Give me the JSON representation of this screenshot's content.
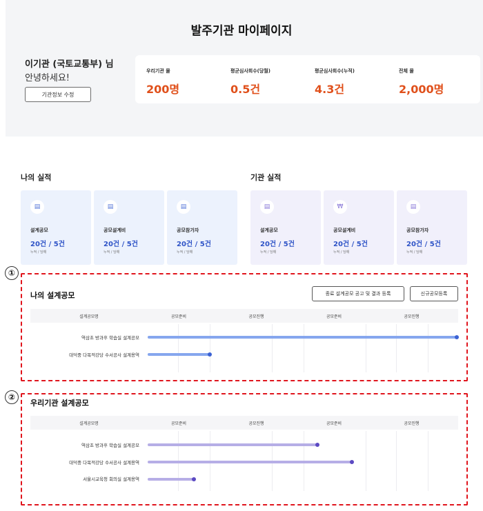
{
  "page": {
    "title": "발주기관 마이페이지"
  },
  "profile": {
    "name": "이기관 (국토교통부) 님",
    "greeting": "안녕하세요!",
    "edit_button": "기관정보 수정"
  },
  "stats": [
    {
      "label": "우리기관 몰",
      "value": "200명"
    },
    {
      "label": "평균심사회수(당월)",
      "value": "0.5건"
    },
    {
      "label": "평균심사회수(누적)",
      "value": "4.3건"
    },
    {
      "label": "전체 몰",
      "value": "2,000명"
    }
  ],
  "my_performance": {
    "title": "나의 실적",
    "cards": [
      {
        "icon": "document-icon",
        "label": "설계공모",
        "value": "20건 / 5건",
        "sub": "누적 / 당해"
      },
      {
        "icon": "document-icon",
        "label": "공모설계비",
        "value": "20건 / 5건",
        "sub": "누적 / 당해"
      },
      {
        "icon": "document-icon",
        "label": "공모참가자",
        "value": "20건 / 5건",
        "sub": "누적 / 당해"
      }
    ]
  },
  "org_performance": {
    "title": "기관 실적",
    "cards": [
      {
        "icon": "document-icon",
        "label": "설계공모",
        "value": "20건 / 5건",
        "sub": "누적 / 당해"
      },
      {
        "icon": "won-icon",
        "label": "공모설계비",
        "value": "20건 / 5건",
        "sub": "누적 / 당해"
      },
      {
        "icon": "document-icon",
        "label": "공모참가자",
        "value": "20건 / 5건",
        "sub": "누적 / 당해"
      }
    ]
  },
  "annotations": [
    "①",
    "②"
  ],
  "my_contests": {
    "title": "나의 설계공모",
    "buttons": {
      "register_results": "종료 설계공모 공고 및 결과 등록",
      "new_contest": "신규공모등록"
    },
    "columns": [
      "설계공모명",
      "공모준비",
      "공모진행",
      "공모준비",
      "공모진행"
    ],
    "rows": [
      {
        "name": "역삼초 방과후 학습실 설계공모",
        "progress": 1.0
      },
      {
        "name": "대덕중 다목적강당 수서공사 설계용역",
        "progress": 0.2
      }
    ]
  },
  "org_contests": {
    "title": "우리기관 설계공모",
    "columns": [
      "설계공모명",
      "공모준비",
      "공모진행",
      "공모준비",
      "공모진행"
    ],
    "rows": [
      {
        "name": "역삼초 방과후 학습실 설계공모",
        "progress": 0.55
      },
      {
        "name": "대덕중 다목적강당 수서공사 설계용역",
        "progress": 0.66
      },
      {
        "name": "서울시교육청 회의실 설계용역",
        "progress": 0.15
      }
    ]
  },
  "colors": {
    "accent_orange": "#e0501b",
    "my_bar": "#86a6ee",
    "my_bar_dot": "#3c63d4",
    "org_bar": "#b6aee6",
    "org_bar_dot": "#5b49c2",
    "annotation_red": "#e0141c"
  }
}
